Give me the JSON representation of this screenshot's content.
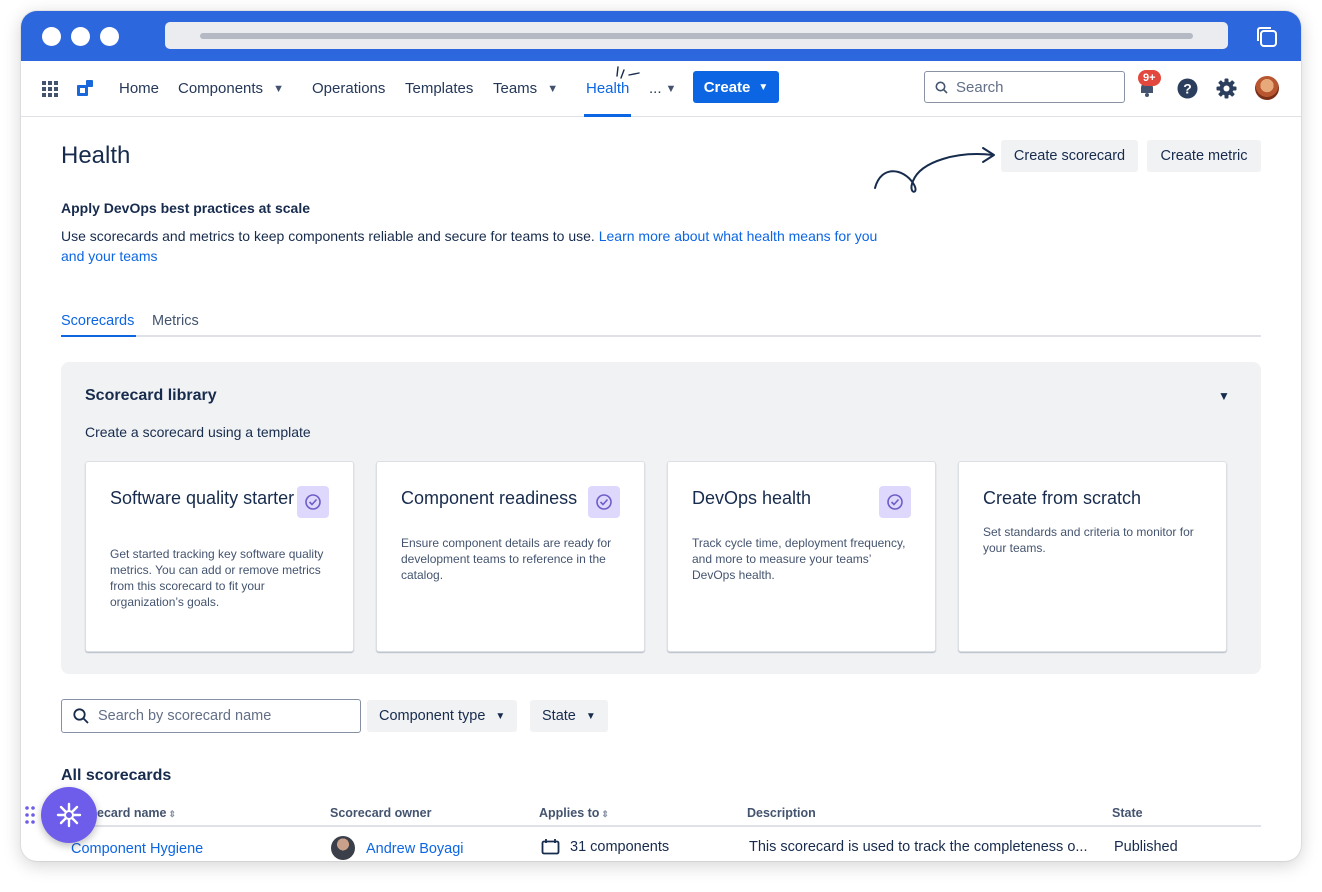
{
  "nav": {
    "items": [
      {
        "label": "Home"
      },
      {
        "label": "Components"
      },
      {
        "label": "Operations"
      },
      {
        "label": "Templates"
      },
      {
        "label": "Teams"
      },
      {
        "label": "Health"
      },
      {
        "label": "..."
      }
    ],
    "active": "Health",
    "create_label": "Create",
    "search_placeholder": "Search",
    "notification_badge": "9+"
  },
  "page": {
    "title": "Health",
    "create_scorecard_label": "Create scorecard",
    "create_metric_label": "Create metric",
    "subtitle": "Apply DevOps best practices at scale",
    "description": "Use scorecards and metrics to keep components reliable and secure for teams to use.",
    "learn_more": "Learn more about what health means for you and your teams"
  },
  "tabs": [
    {
      "label": "Scorecards"
    },
    {
      "label": "Metrics"
    }
  ],
  "library": {
    "title": "Scorecard library",
    "subtitle": "Create a scorecard using a template",
    "cards": [
      {
        "title": "Software quality starter",
        "desc": "Get started tracking key software quality metrics. You can add or remove metrics from this scorecard to fit your organization’s goals.",
        "icon": "check-circle-icon"
      },
      {
        "title": "Component readiness",
        "desc": "Ensure component details are ready for development teams to reference in the catalog.",
        "icon": "check-circle-icon"
      },
      {
        "title": "DevOps health",
        "desc": "Track cycle time, deployment frequency, and more to measure your teams’ DevOps health.",
        "icon": "check-circle-icon"
      },
      {
        "title": "Create from scratch",
        "desc": "Set standards and criteria to monitor for your teams."
      }
    ]
  },
  "filters": {
    "search_placeholder": "Search by scorecard name",
    "component_type_label": "Component type",
    "state_label": "State"
  },
  "table": {
    "title": "All scorecards",
    "headers": {
      "name": "Scorecard name",
      "name_visible": "ecard name",
      "owner": "Scorecard owner",
      "applies_to": "Applies to",
      "description": "Description",
      "state": "State"
    },
    "rows": [
      {
        "name": "Component Hygiene",
        "owner": "Andrew Boyagi",
        "applies_to": "31 components",
        "description": "This scorecard is used to track the completeness o...",
        "state": "Published"
      }
    ]
  },
  "colors": {
    "brand_blue": "#2d67dd",
    "primary": "#0c66e4",
    "fab_purple": "#6e5dea",
    "badge_red": "#e2483d"
  }
}
